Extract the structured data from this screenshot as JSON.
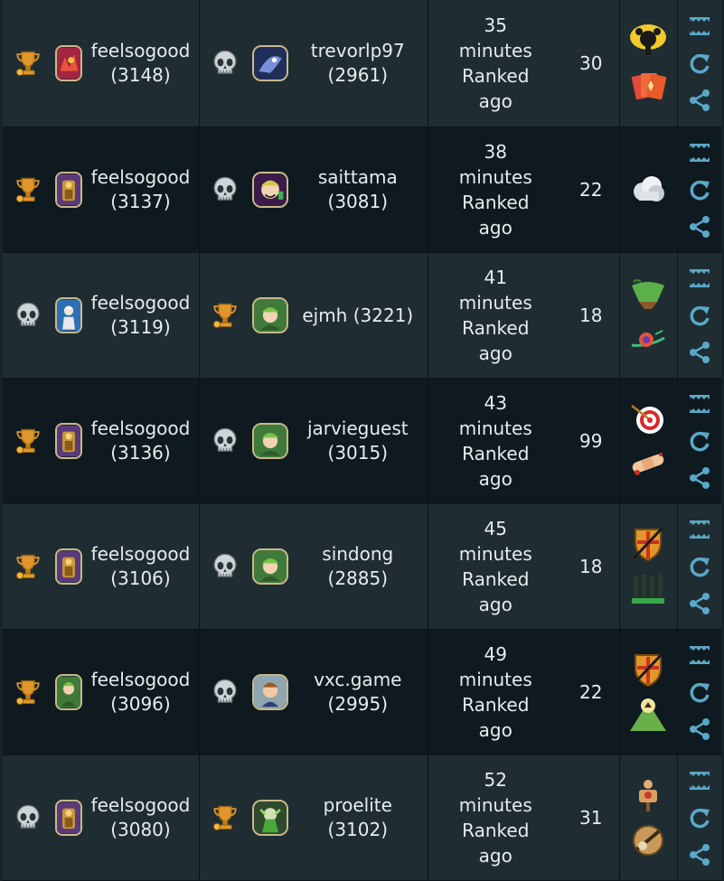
{
  "colors": {
    "accent": "#5aa8c8",
    "trophy": "#e0962a",
    "skull": "#cfd4d6"
  },
  "matches": [
    {
      "p1": {
        "result": "win",
        "name": "feelsogood (3148)"
      },
      "p2": {
        "result": "loss",
        "name": "trevorlp97 (2961)"
      },
      "time": "35\nminutes Ranked\nago",
      "turns": "30",
      "cards": [
        "bomb-icon",
        "cards-icon"
      ]
    },
    {
      "p1": {
        "result": "win",
        "name": "feelsogood (3137)"
      },
      "p2": {
        "result": "loss",
        "name": "saittama (3081)"
      },
      "time": "38\nminutes Ranked\nago",
      "turns": "22",
      "cards": [
        "cloud-icon"
      ]
    },
    {
      "p1": {
        "result": "loss",
        "name": "feelsogood (3119)"
      },
      "p2": {
        "result": "win",
        "name": "ejmh (3221)"
      },
      "time": "41\nminutes Ranked\nago",
      "turns": "18",
      "cards": [
        "island-icon",
        "snail-icon"
      ]
    },
    {
      "p1": {
        "result": "win",
        "name": "feelsogood (3136)"
      },
      "p2": {
        "result": "loss",
        "name": "jarvieguest (3015)"
      },
      "time": "43\nminutes Ranked\nago",
      "turns": "99",
      "cards": [
        "target-icon",
        "bandage-icon"
      ]
    },
    {
      "p1": {
        "result": "win",
        "name": "feelsogood (3106)"
      },
      "p2": {
        "result": "loss",
        "name": "sindong (2885)"
      },
      "time": "45\nminutes Ranked\nago",
      "turns": "18",
      "cards": [
        "shield-icon",
        "bars-icon"
      ]
    },
    {
      "p1": {
        "result": "win",
        "name": "feelsogood (3096)"
      },
      "p2": {
        "result": "loss",
        "name": "vxc.game (2995)"
      },
      "time": "49\nminutes Ranked\nago",
      "turns": "22",
      "cards": [
        "shield-icon",
        "mountain-icon"
      ]
    },
    {
      "p1": {
        "result": "loss",
        "name": "feelsogood (3080)"
      },
      "p2": {
        "result": "win",
        "name": "proelite (3102)"
      },
      "time": "52\nminutes Ranked\nago",
      "turns": "31",
      "cards": [
        "dummy-icon",
        "scroll-icon"
      ]
    }
  ]
}
